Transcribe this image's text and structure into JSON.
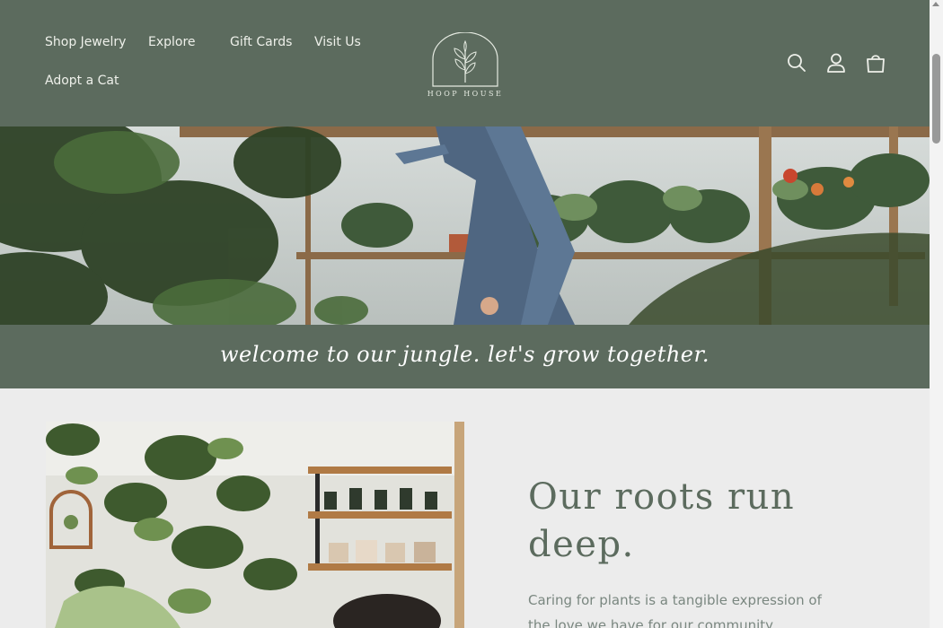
{
  "header": {
    "nav": [
      {
        "label": "Shop Jewelry"
      },
      {
        "label": "Explore"
      },
      {
        "label": "Gift Cards"
      },
      {
        "label": "Visit Us"
      },
      {
        "label": "Adopt a Cat"
      }
    ],
    "logo_text": "HOOP HOUSE",
    "icons": [
      "search-icon",
      "account-icon",
      "cart-icon"
    ]
  },
  "banner": {
    "text": "welcome to our jungle. let's grow together."
  },
  "about": {
    "heading": "Our roots run deep.",
    "body": "Caring for plants is a tangible expression of the love we have for our community"
  },
  "colors": {
    "brand_green": "#5c6b5e",
    "page_bg": "#ececec",
    "body_text": "#7a8780"
  }
}
